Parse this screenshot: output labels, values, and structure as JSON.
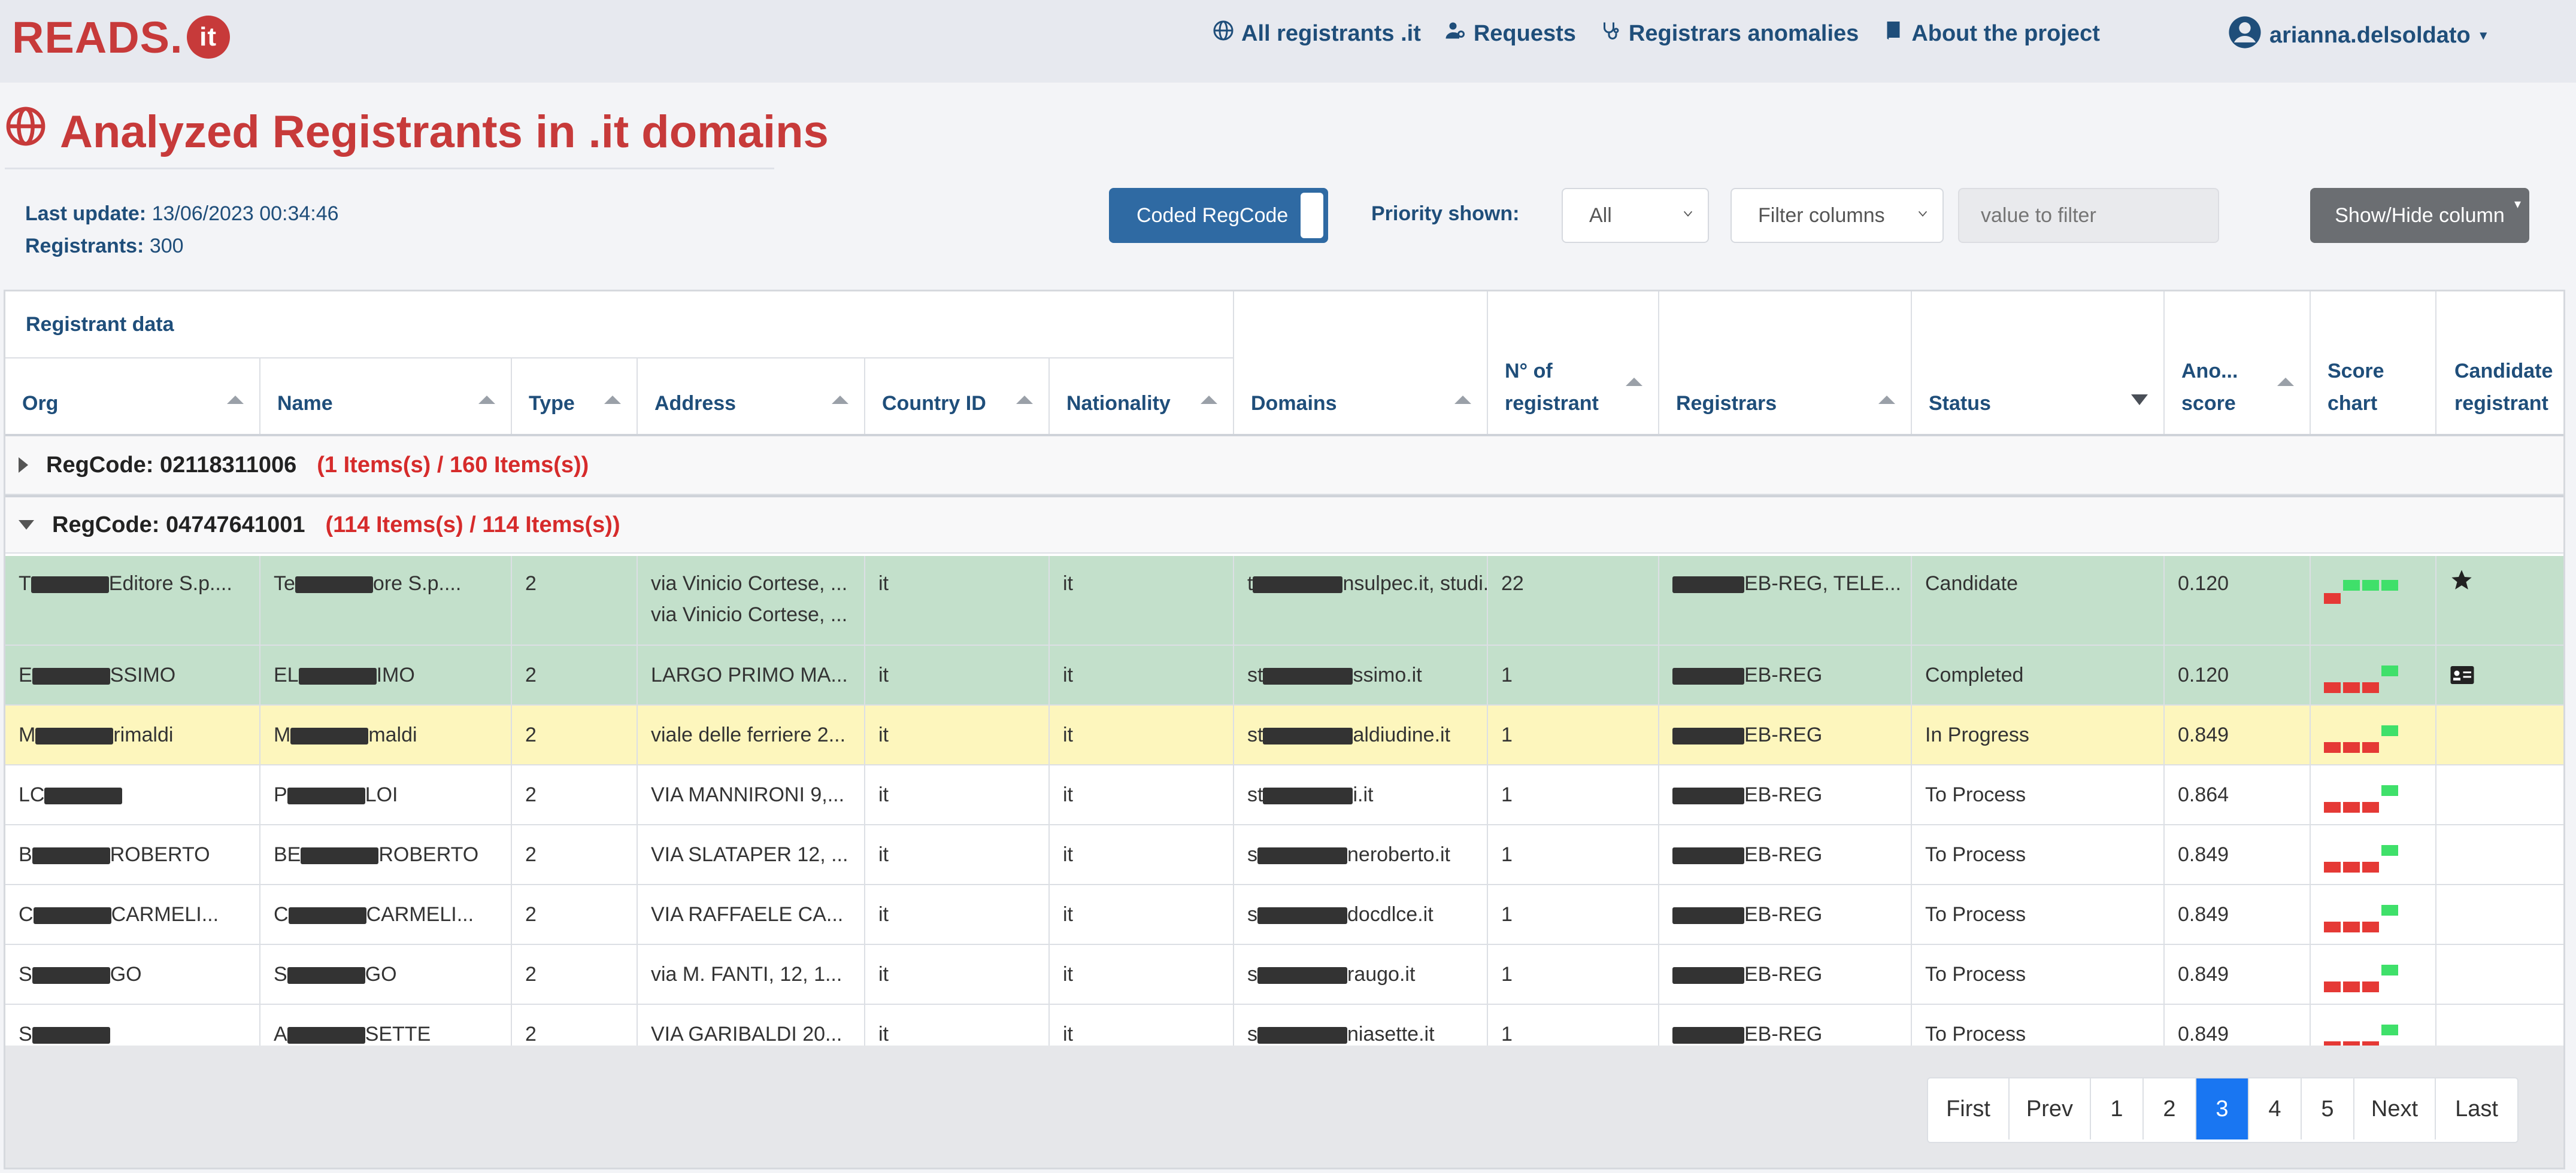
{
  "brand": {
    "name": "READS.",
    "logo_glyph": "it"
  },
  "nav": {
    "links": [
      "All registrants .it",
      "Requests",
      "Registrars anomalies",
      "About the project"
    ],
    "user": "arianna.delsoldato"
  },
  "page": {
    "title": "Analyzed Registrants in .it domains"
  },
  "meta": {
    "last_update_label": "Last update:",
    "last_update_value": "13/06/2023 00:34:46",
    "registrants_label": "Registrants:",
    "registrants_value": "300"
  },
  "controls": {
    "coded_toggle_label": "Coded RegCode",
    "priority_label": "Priority shown:",
    "priority_value": "All",
    "filter_columns": "Filter columns",
    "filter_placeholder": "value to filter",
    "show_hide": "Show/Hide column"
  },
  "table": {
    "group_header": "Registrant data",
    "columns": [
      {
        "label": "Org"
      },
      {
        "label": "Name"
      },
      {
        "label": "Type"
      },
      {
        "label": "Address"
      },
      {
        "label": "Country ID"
      },
      {
        "label": "Nationality"
      },
      {
        "label": "Domains"
      },
      {
        "label": "N° of registrant"
      },
      {
        "label": "Registrars"
      },
      {
        "label": "Status"
      },
      {
        "label": "Ano... score"
      },
      {
        "label": "Score chart"
      },
      {
        "label": "Candidate registrant"
      }
    ],
    "groups": [
      {
        "label": "RegCode: 02118311006",
        "count": "(1 Items(s) / 160 Items(s))",
        "expanded": false
      },
      {
        "label": "RegCode: 04747641001",
        "count": "(114 Items(s) / 114 Items(s))",
        "expanded": true
      }
    ],
    "rows": [
      {
        "org_pre": "T",
        "org_post": "Editore S.p....",
        "name_pre": "Te",
        "name_post": "ore S.p....",
        "type": "2",
        "address": "via Vinicio Cortese, ...",
        "address2": "via Vinicio Cortese, ...",
        "country": "it",
        "nationality": "it",
        "domains_pre": "t",
        "domains_post": "nsulpec.it, studi...",
        "n_reg": "22",
        "registrars_post": "EB-REG, TELE...",
        "status": "Candidate",
        "score": "0.120",
        "chart_red": 1,
        "chart_green": 3,
        "candidate_icon": "star-icon",
        "highlight": "green"
      },
      {
        "org_pre": "E",
        "org_post": "SSIMO",
        "name_pre": "EL",
        "name_post": "IMO",
        "type": "2",
        "address": "LARGO PRIMO MA...",
        "address2": "",
        "country": "it",
        "nationality": "it",
        "domains_pre": "st",
        "domains_post": "ssimo.it",
        "n_reg": "1",
        "registrars_post": "EB-REG",
        "status": "Completed",
        "score": "0.120",
        "chart_red": 3,
        "chart_green": 1,
        "candidate_icon": "id-card-icon",
        "highlight": "green"
      },
      {
        "org_pre": "M",
        "org_post": "rimaldi",
        "name_pre": "M",
        "name_post": "maldi",
        "type": "2",
        "address": "viale delle ferriere 2...",
        "address2": "",
        "country": "it",
        "nationality": "it",
        "domains_pre": "st",
        "domains_post": "aldiudine.it",
        "n_reg": "1",
        "registrars_post": "EB-REG",
        "status": "In Progress",
        "score": "0.849",
        "chart_red": 3,
        "chart_green": 1,
        "candidate_icon": "",
        "highlight": "yellow"
      },
      {
        "org_pre": "LC",
        "org_post": "",
        "name_pre": "P",
        "name_post": "LOI",
        "type": "2",
        "address": "VIA MANNIRONI 9,...",
        "address2": "",
        "country": "it",
        "nationality": "it",
        "domains_pre": "st",
        "domains_post": "i.it",
        "n_reg": "1",
        "registrars_post": "EB-REG",
        "status": "To Process",
        "score": "0.864",
        "chart_red": 3,
        "chart_green": 1,
        "candidate_icon": "",
        "highlight": "white"
      },
      {
        "org_pre": "B",
        "org_post": "ROBERTO",
        "name_pre": "BE",
        "name_post": "ROBERTO",
        "type": "2",
        "address": "VIA SLATAPER 12, ...",
        "address2": "",
        "country": "it",
        "nationality": "it",
        "domains_pre": "s",
        "domains_post": "neroberto.it",
        "n_reg": "1",
        "registrars_post": "EB-REG",
        "status": "To Process",
        "score": "0.849",
        "chart_red": 3,
        "chart_green": 1,
        "candidate_icon": "",
        "highlight": "white"
      },
      {
        "org_pre": "C",
        "org_post": "CARMELI...",
        "name_pre": "C",
        "name_post": "CARMELI...",
        "type": "2",
        "address": "VIA RAFFAELE CA...",
        "address2": "",
        "country": "it",
        "nationality": "it",
        "domains_pre": "s",
        "domains_post": "docdlce.it",
        "n_reg": "1",
        "registrars_post": "EB-REG",
        "status": "To Process",
        "score": "0.849",
        "chart_red": 3,
        "chart_green": 1,
        "candidate_icon": "",
        "highlight": "white"
      },
      {
        "org_pre": "S",
        "org_post": "GO",
        "name_pre": "S",
        "name_post": "GO",
        "type": "2",
        "address": "via M. FANTI, 12, 1...",
        "address2": "",
        "country": "it",
        "nationality": "it",
        "domains_pre": "s",
        "domains_post": "raugo.it",
        "n_reg": "1",
        "registrars_post": "EB-REG",
        "status": "To Process",
        "score": "0.849",
        "chart_red": 3,
        "chart_green": 1,
        "candidate_icon": "",
        "highlight": "white"
      },
      {
        "org_pre": "S",
        "org_post": "",
        "name_pre": "A",
        "name_post": "SETTE",
        "type": "2",
        "address": "VIA GARIBALDI 20...",
        "address2": "",
        "country": "it",
        "nationality": "it",
        "domains_pre": "s",
        "domains_post": "niasette.it",
        "n_reg": "1",
        "registrars_post": "EB-REG",
        "status": "To Process",
        "score": "0.849",
        "chart_red": 3,
        "chart_green": 1,
        "candidate_icon": "",
        "highlight": "white"
      }
    ]
  },
  "pagination": {
    "buttons": [
      "First",
      "Prev",
      "1",
      "2",
      "3",
      "4",
      "5",
      "Next",
      "Last"
    ],
    "active": "3"
  }
}
